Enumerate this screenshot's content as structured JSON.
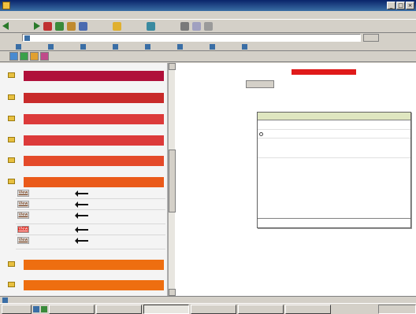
{
  "window": {
    "title": ""
  },
  "menubar": [
    "",
    "",
    "",
    "",
    "",
    ""
  ],
  "toolbar": {
    "back_label": "",
    "search_label": "",
    "favorites_label": "",
    "media_label": ""
  },
  "address": {
    "label": "",
    "url": "",
    "go_label": ""
  },
  "links": {
    "label": "",
    "items": [
      "",
      "",
      "",
      "",
      "",
      "",
      "",
      ""
    ]
  },
  "colors": {
    "highlight": "#e01a1a",
    "body_text": "#2a3a9a",
    "popup_header": "#dfe6c0"
  },
  "sidebar": {
    "categories": [
      {
        "label": ""
      },
      {
        "label": ""
      },
      {
        "label": ""
      },
      {
        "label": ""
      },
      {
        "label": ""
      },
      {
        "label": ""
      },
      {
        "label": ""
      },
      {
        "label": ""
      }
    ],
    "acquisitions": [
      {
        "view": "View",
        "from": "",
        "to": ""
      },
      {
        "view": "View",
        "from": "",
        "to": ""
      },
      {
        "view": "View",
        "from": "",
        "to": ""
      },
      {
        "view": "View",
        "from": "",
        "to": ""
      },
      {
        "view": "View",
        "from": "",
        "to": ""
      }
    ]
  },
  "article": {
    "lines": [
      "",
      "",
      "",
      "",
      "",
      "",
      "",
      "",
      "",
      "",
      "",
      "",
      "",
      "",
      "",
      "",
      "",
      "",
      "",
      "",
      "",
      "",
      "",
      "",
      "",
      ""
    ],
    "deal_button": ""
  },
  "popup": {
    "title": "",
    "rows": [
      {
        "key": "",
        "value": ""
      },
      {
        "key": "",
        "value": ""
      },
      {
        "key": "",
        "value": ""
      },
      {
        "key": "",
        "value": ""
      }
    ]
  },
  "status": {
    "text": "",
    "zone": ""
  },
  "taskbar": {
    "start": "",
    "tasks": [
      "",
      "",
      "",
      "",
      "",
      ""
    ],
    "clock": ""
  }
}
